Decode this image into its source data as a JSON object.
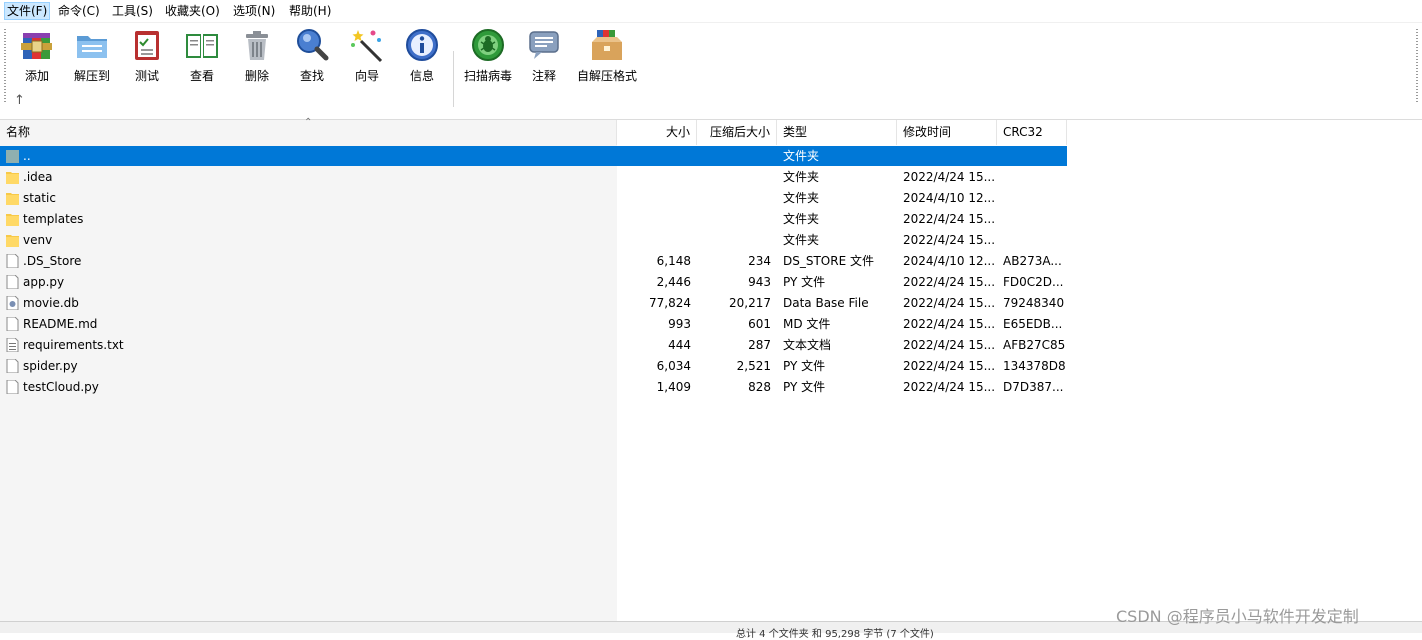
{
  "menu": [
    "文件(F)",
    "命令(C)",
    "工具(S)",
    "收藏夹(O)",
    "选项(N)",
    "帮助(H)"
  ],
  "toolbar": [
    {
      "label": "添加",
      "icon": "add-archive-icon"
    },
    {
      "label": "解压到",
      "icon": "extract-folder-icon"
    },
    {
      "label": "测试",
      "icon": "test-clipboard-icon"
    },
    {
      "label": "查看",
      "icon": "view-book-icon"
    },
    {
      "label": "删除",
      "icon": "trash-icon"
    },
    {
      "label": "查找",
      "icon": "magnifier-icon"
    },
    {
      "label": "向导",
      "icon": "wizard-wand-icon"
    },
    {
      "label": "信息",
      "icon": "info-icon"
    },
    {
      "label": "扫描病毒",
      "icon": "virus-scan-icon"
    },
    {
      "label": "注释",
      "icon": "comment-icon"
    },
    {
      "label": "自解压格式",
      "icon": "sfx-box-icon"
    }
  ],
  "columns": {
    "name": "名称",
    "size": "大小",
    "packed": "压缩后大小",
    "type": "类型",
    "modified": "修改时间",
    "crc": "CRC32"
  },
  "files": [
    {
      "name": "..",
      "size": "",
      "packed": "",
      "type": "文件夹",
      "modified": "",
      "crc": "",
      "kind": "parent"
    },
    {
      "name": ".idea",
      "size": "",
      "packed": "",
      "type": "文件夹",
      "modified": "2022/4/24 15...",
      "crc": "",
      "kind": "folder"
    },
    {
      "name": "static",
      "size": "",
      "packed": "",
      "type": "文件夹",
      "modified": "2024/4/10 12...",
      "crc": "",
      "kind": "folder"
    },
    {
      "name": "templates",
      "size": "",
      "packed": "",
      "type": "文件夹",
      "modified": "2022/4/24 15...",
      "crc": "",
      "kind": "folder"
    },
    {
      "name": "venv",
      "size": "",
      "packed": "",
      "type": "文件夹",
      "modified": "2022/4/24 15...",
      "crc": "",
      "kind": "folder"
    },
    {
      "name": ".DS_Store",
      "size": "6,148",
      "packed": "234",
      "type": "DS_STORE 文件",
      "modified": "2024/4/10 12...",
      "crc": "AB273A...",
      "kind": "file"
    },
    {
      "name": "app.py",
      "size": "2,446",
      "packed": "943",
      "type": "PY 文件",
      "modified": "2022/4/24 15...",
      "crc": "FD0C2D...",
      "kind": "file"
    },
    {
      "name": "movie.db",
      "size": "77,824",
      "packed": "20,217",
      "type": "Data Base File",
      "modified": "2022/4/24 15...",
      "crc": "79248340",
      "kind": "db"
    },
    {
      "name": "README.md",
      "size": "993",
      "packed": "601",
      "type": "MD 文件",
      "modified": "2022/4/24 15...",
      "crc": "E65EDB...",
      "kind": "file"
    },
    {
      "name": "requirements.txt",
      "size": "444",
      "packed": "287",
      "type": "文本文档",
      "modified": "2022/4/24 15...",
      "crc": "AFB27C85",
      "kind": "text"
    },
    {
      "name": "spider.py",
      "size": "6,034",
      "packed": "2,521",
      "type": "PY 文件",
      "modified": "2022/4/24 15...",
      "crc": "134378D8",
      "kind": "file"
    },
    {
      "name": "testCloud.py",
      "size": "1,409",
      "packed": "828",
      "type": "PY 文件",
      "modified": "2022/4/24 15...",
      "crc": "D7D387...",
      "kind": "file"
    }
  ],
  "status": {
    "left": "",
    "right": "总计 4 个文件夹 和 95,298 字节 (7 个文件)"
  },
  "watermark": "CSDN @程序员小马软件开发定制",
  "colors": {
    "selection": "#0078d7",
    "folder": "#f7c948",
    "menu_active": "#cce8ff"
  }
}
